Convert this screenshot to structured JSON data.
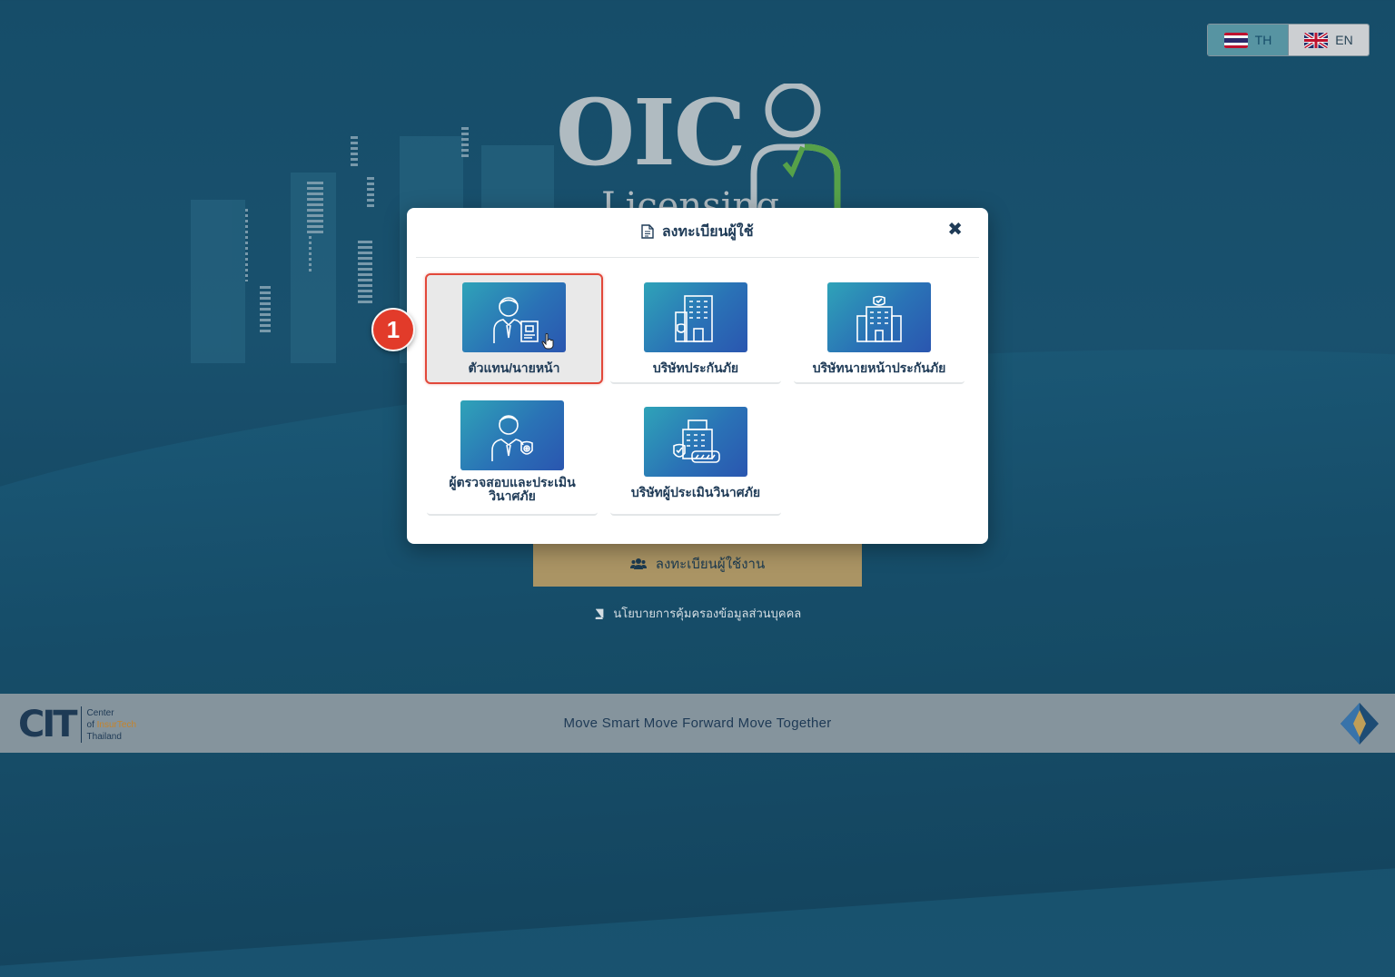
{
  "language": {
    "th_label": "TH",
    "en_label": "EN",
    "selected": "TH"
  },
  "logo": {
    "text": "OIC",
    "subtitle": "Licensing"
  },
  "modal": {
    "title": "ลงทะเบียนผู้ใช้",
    "close_icon": "times-icon",
    "options": [
      {
        "label": "ตัวแทน/นายหน้า",
        "icon": "agent-broker-icon",
        "selected": true
      },
      {
        "label": "บริษัทประกันภัย",
        "icon": "insurance-company-building-icon",
        "selected": false
      },
      {
        "label": "บริษัทนายหน้าประกันภัย",
        "icon": "broker-company-building-icon",
        "selected": false
      },
      {
        "label": "ผู้ตรวจสอบและประเมินวินาศภัย",
        "icon": "loss-adjuster-icon",
        "selected": false
      },
      {
        "label": "บริษัทผู้ประเมินวินาศภัย",
        "icon": "loss-assessment-company-icon",
        "selected": false
      }
    ]
  },
  "step_badge": "1",
  "register_button": {
    "label": "ลงทะเบียนผู้ใช้งาน",
    "icon": "users-icon"
  },
  "privacy": {
    "label": "นโยบายการคุ้มครองข้อมูลส่วนบุคคล",
    "icon": "book-icon"
  },
  "footer": {
    "slogan": "Move Smart Move Forward Move Together",
    "cit_letters": "CIT",
    "cit_line1": "Center",
    "cit_line2_prefix": "of ",
    "cit_line2_accent": "InsurTech",
    "cit_line3": "Thailand"
  },
  "colors": {
    "accent": "#e23b2a",
    "gold_button": "#b39a67",
    "navy": "#1f3b57",
    "background": "#17506c"
  }
}
